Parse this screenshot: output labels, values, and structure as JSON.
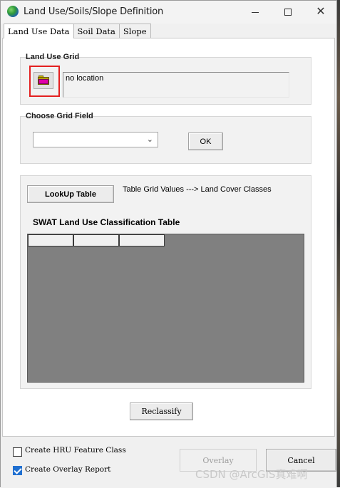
{
  "window": {
    "title": "Land Use/Soils/Slope Definition"
  },
  "tabs": [
    {
      "label": "Land Use Data",
      "active": true
    },
    {
      "label": "Soil Data",
      "active": false
    },
    {
      "label": "Slope",
      "active": false
    }
  ],
  "land_use_grid": {
    "label": "Land Use Grid",
    "browse_icon": "folder-open-icon",
    "location_text": "no location"
  },
  "grid_field": {
    "label": "Choose Grid Field",
    "selected_value": "",
    "ok_label": "OK"
  },
  "lookup": {
    "button_label": "LookUp Table",
    "info_text": "Table Grid Values ---> Land Cover Classes",
    "table_title": "SWAT Land Use Classification Table",
    "columns": [
      "",
      "",
      ""
    ]
  },
  "reclassify_label": "Reclassify",
  "options": {
    "create_hru": {
      "label": "Create HRU Feature Class",
      "checked": false
    },
    "create_overlay": {
      "label": "Create Overlay Report",
      "checked": true
    }
  },
  "buttons": {
    "overlay": "Overlay",
    "cancel": "Cancel"
  },
  "watermark": "CSDN @ArcGIS真难啊",
  "colors": {
    "highlight": "#e32020",
    "check_accent": "#1f6fd0",
    "table_bg": "#808080"
  }
}
